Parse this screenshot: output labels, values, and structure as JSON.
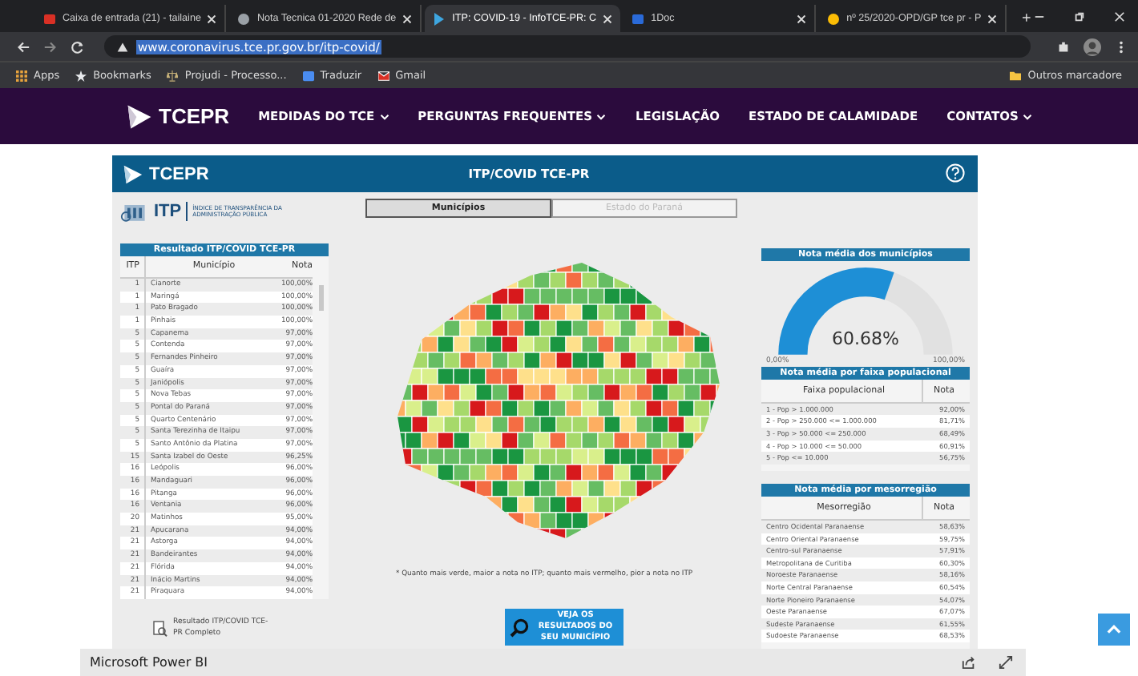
{
  "browser": {
    "tabs": [
      {
        "title": "Caixa de entrada (21) - tailaine",
        "selected": false
      },
      {
        "title": "Nota Tecnica 01-2020 Rede de",
        "selected": false
      },
      {
        "title": "ITP: COVID-19 - InfoTCE-PR: C",
        "selected": true
      },
      {
        "title": "1Doc",
        "selected": false
      },
      {
        "title": "nº 25/2020-OPD/GP tce pr - P",
        "selected": false
      }
    ],
    "address": "www.coronavirus.tce.pr.gov.br/itp-covid/",
    "bookmarks": [
      "Apps",
      "Bookmarks",
      "Projudi - Processo...",
      "Traduzir",
      "Gmail"
    ],
    "other_bookmarks": "Outros marcadore"
  },
  "site_nav": {
    "logo": "TCEPR",
    "items": [
      {
        "label": "MEDIDAS DO TCE",
        "dropdown": true
      },
      {
        "label": "PERGUNTAS FREQUENTES",
        "dropdown": true
      },
      {
        "label": "LEGISLAÇÃO",
        "dropdown": false
      },
      {
        "label": "ESTADO DE CALAMIDADE",
        "dropdown": false
      },
      {
        "label": "CONTATOS",
        "dropdown": true
      }
    ]
  },
  "report": {
    "logo": "TCEPR",
    "title": "ITP/COVID TCE-PR",
    "itp_logo": {
      "name": "ITP",
      "subtitle": "ÍNDICE DE TRANSPARÊNCIA DA ADMINISTRAÇÃO PÚBLICA"
    },
    "toggle": [
      {
        "label": "Municípios",
        "selected": true
      },
      {
        "label": "Estado do Paraná",
        "selected": false
      }
    ],
    "ranking": {
      "title": "Resultado ITP/COVID TCE-PR",
      "columns": [
        "ITP",
        "Município",
        "Nota"
      ],
      "rows": [
        [
          "1",
          "Cianorte",
          "100,00%"
        ],
        [
          "1",
          "Maringá",
          "100,00%"
        ],
        [
          "1",
          "Pato Bragado",
          "100,00%"
        ],
        [
          "1",
          "Pinhais",
          "100,00%"
        ],
        [
          "5",
          "Capanema",
          "97,00%"
        ],
        [
          "5",
          "Contenda",
          "97,00%"
        ],
        [
          "5",
          "Fernandes Pinheiro",
          "97,00%"
        ],
        [
          "5",
          "Guaíra",
          "97,00%"
        ],
        [
          "5",
          "Janiópolis",
          "97,00%"
        ],
        [
          "5",
          "Nova Tebas",
          "97,00%"
        ],
        [
          "5",
          "Pontal do Paraná",
          "97,00%"
        ],
        [
          "5",
          "Quarto Centenário",
          "97,00%"
        ],
        [
          "5",
          "Santa Terezinha de Itaipu",
          "97,00%"
        ],
        [
          "5",
          "Santo Antônio da Platina",
          "97,00%"
        ],
        [
          "15",
          "Santa Izabel do Oeste",
          "96,25%"
        ],
        [
          "16",
          "Leópolis",
          "96,00%"
        ],
        [
          "16",
          "Mandaguari",
          "96,00%"
        ],
        [
          "16",
          "Pitanga",
          "96,00%"
        ],
        [
          "16",
          "Ventania",
          "96,00%"
        ],
        [
          "20",
          "Matinhos",
          "95,00%"
        ],
        [
          "21",
          "Apucarana",
          "94,00%"
        ],
        [
          "21",
          "Astorga",
          "94,00%"
        ],
        [
          "21",
          "Bandeirantes",
          "94,00%"
        ],
        [
          "21",
          "Flórida",
          "94,00%"
        ],
        [
          "21",
          "Inácio Martins",
          "94,00%"
        ],
        [
          "21",
          "Piraquara",
          "94,00%"
        ]
      ]
    },
    "download": "Resultado ITP/COVID TCE-PR Completo",
    "map_note": "* Quanto mais verde, maior a nota no ITP; quanto mais vermelho, pior a nota no ITP",
    "search_button": "VEJA OS RESULTADOS DO SEU MUNICÍPIO",
    "gauge": {
      "title": "Nota média dos municípios",
      "value": "60.68%",
      "min": "0,00%",
      "max": "100,00%"
    },
    "population": {
      "title": "Nota média por faixa populacional",
      "columns": [
        "Faixa populacional",
        "Nota"
      ],
      "rows": [
        [
          "1 - Pop > 1.000.000",
          "92,00%"
        ],
        [
          "2 - Pop > 250.000 <= 1.000.000",
          "81,71%"
        ],
        [
          "3 - Pop > 50.000 <= 250.000",
          "68,49%"
        ],
        [
          "4 - Pop > 10.000 <= 50.000",
          "60,91%"
        ],
        [
          "5 - Pop <= 10.000",
          "56,75%"
        ]
      ]
    },
    "mesoregion": {
      "title": "Nota média por mesorregião",
      "columns": [
        "Mesorregião",
        "Nota"
      ],
      "rows": [
        [
          "Centro Ocidental Paranaense",
          "58,63%"
        ],
        [
          "Centro Oriental Paranaense",
          "59,75%"
        ],
        [
          "Centro-sul Paranaense",
          "57,91%"
        ],
        [
          "Metropolitana de Curitiba",
          "60,30%"
        ],
        [
          "Noroeste Paranaense",
          "58,16%"
        ],
        [
          "Norte Central Paranaense",
          "60,54%"
        ],
        [
          "Norte Pioneiro Paranaense",
          "54,07%"
        ],
        [
          "Oeste Paranaense",
          "67,07%"
        ],
        [
          "Sudeste Paranaense",
          "61,55%"
        ],
        [
          "Sudoeste Paranaense",
          "68,53%"
        ]
      ]
    }
  },
  "footer": {
    "label": "Microsoft Power BI"
  }
}
